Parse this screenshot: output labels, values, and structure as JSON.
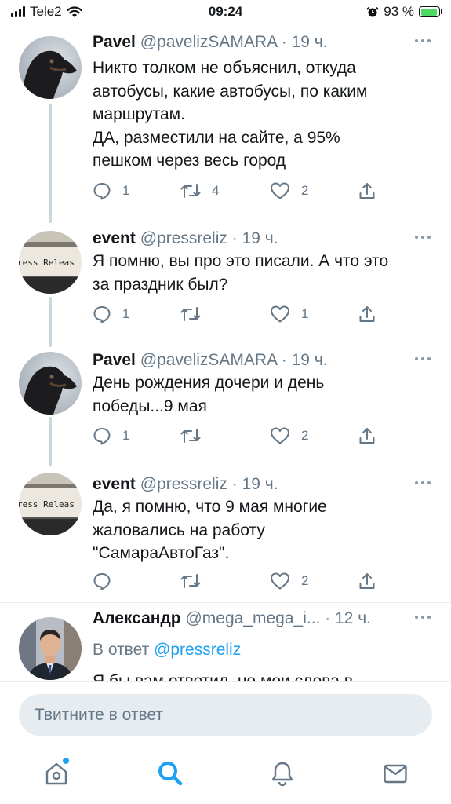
{
  "status_bar": {
    "carrier": "Tele2",
    "time": "09:24",
    "battery": "93 %",
    "battery_level": 0.93,
    "icons": [
      "signal-icon",
      "wifi-icon",
      "alarm-icon",
      "battery-charging-icon"
    ]
  },
  "tweets": [
    {
      "name": "Pavel",
      "handle": "@pavelizSAMARA",
      "sep": " · ",
      "time": "19 ч.",
      "text": "Никто толком не объяснил, откуда\nавтобусы, какие автобусы, по каким\nмаршрутам.\nДА, разместили на сайте, а  95%\nпешком через весь город",
      "replies": "1",
      "retweets": "4",
      "likes": "2"
    },
    {
      "name": "event",
      "handle": "@pressreliz",
      "sep": " · ",
      "time": "19 ч.",
      "avatar_text": "ress Releas",
      "text": "Я помню, вы про это писали. А что это\nза праздник был?",
      "replies": "1",
      "retweets": "",
      "likes": "1"
    },
    {
      "name": "Pavel",
      "handle": "@pavelizSAMARA",
      "sep": " · ",
      "time": "19 ч.",
      "text": "День рождения дочери и день\nпобеды...9 мая",
      "replies": "1",
      "retweets": "",
      "likes": "2"
    },
    {
      "name": "event",
      "handle": "@pressreliz",
      "sep": " · ",
      "time": "19 ч.",
      "avatar_text": "ress Releas",
      "text": "Да, я помню, что 9 мая многие\nжаловались на работу\n\"СамараАвтоГаз\".",
      "replies": "",
      "retweets": "",
      "likes": "2"
    },
    {
      "name": "Александр",
      "handle": "@mega_mega_i...",
      "sep": " · ",
      "time": "12 ч.",
      "reply_prefix": "В ответ ",
      "reply_to": "@pressreliz",
      "text": "Я бы вам ответил, но мои слова в"
    }
  ],
  "reply_bar": {
    "placeholder": "Твитните в ответ"
  },
  "tab_bar": {
    "items": [
      "home-icon",
      "search-icon",
      "notifications-icon",
      "messages-icon"
    ],
    "active": "search-icon"
  },
  "colors": {
    "accent": "#1da1f2",
    "secondary_text": "#657786",
    "primary_text": "#14171a",
    "separator": "#e6ecf0"
  }
}
